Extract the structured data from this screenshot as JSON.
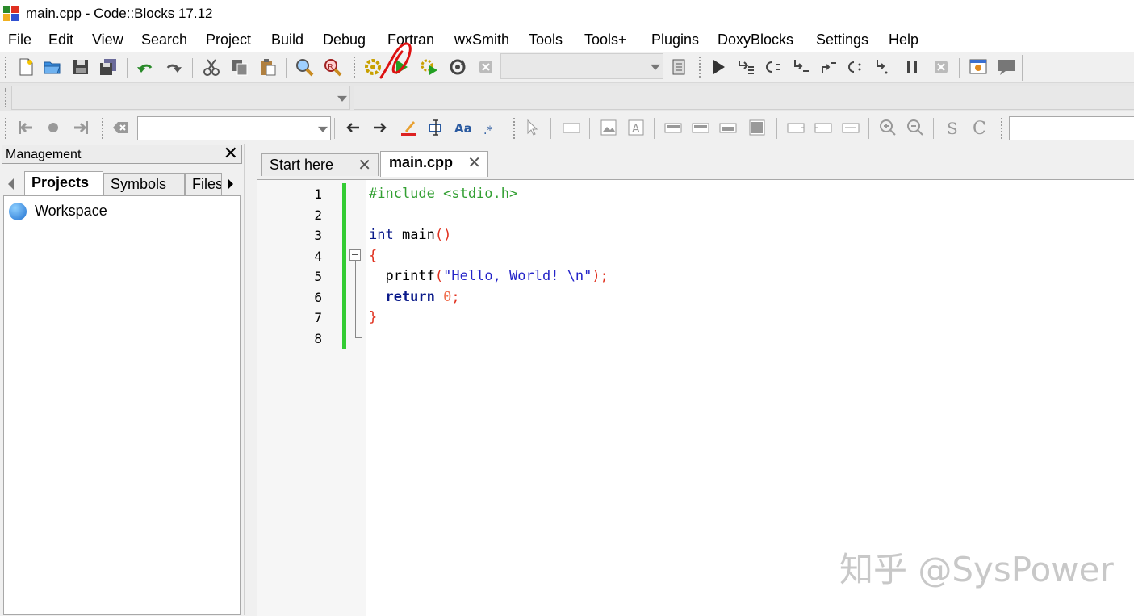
{
  "window": {
    "title": "main.cpp - Code::Blocks 17.12"
  },
  "menu": [
    "File",
    "Edit",
    "View",
    "Search",
    "Project",
    "Build",
    "Debug",
    "Fortran",
    "wxSmith",
    "Tools",
    "Tools+",
    "Plugins",
    "DoxyBlocks",
    "Settings",
    "Help"
  ],
  "management": {
    "title": "Management",
    "close_label": "✕",
    "tabs": [
      "Projects",
      "Symbols",
      "Files"
    ],
    "active_tab": "Projects",
    "tree": [
      {
        "label": "Workspace",
        "icon": "workspace-icon"
      }
    ]
  },
  "editor": {
    "tabs": [
      {
        "label": "Start here",
        "active": false
      },
      {
        "label": "main.cpp",
        "active": true
      }
    ],
    "close_label": "✕",
    "line_numbers": [
      "1",
      "2",
      "3",
      "4",
      "5",
      "6",
      "7",
      "8"
    ],
    "code": {
      "l1_pp": "#include <stdio.h>",
      "l3_kw": "int",
      "l3_fn": " main",
      "l3_br": "()",
      "l4_br": "{",
      "l5_fn": "  printf",
      "l5_open": "(",
      "l5_str": "\"Hello, World! \\n\"",
      "l5_close": ");",
      "l6_kw": "  return",
      "l6_num": " 0",
      "l6_semi": ";",
      "l7_br": "}"
    }
  },
  "watermark": "知乎 @SysPower",
  "colors": {
    "annotation": "#dd1111",
    "change_bar": "#33cc33",
    "preprocessor": "#33a033",
    "keyword": "#0a1a8a",
    "string": "#2424c8"
  }
}
